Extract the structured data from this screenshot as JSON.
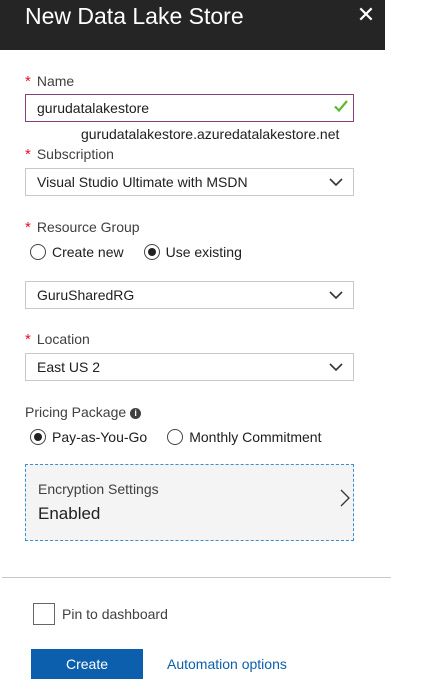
{
  "header": {
    "title": "New Data Lake Store",
    "close_glyph": "✕"
  },
  "required_marker": "*",
  "name_field": {
    "label": "Name",
    "value": "gurudatalakestore",
    "hint": "gurudatalakestore.azuredatalakestore.net",
    "valid_icon": "check-icon"
  },
  "subscription": {
    "label": "Subscription",
    "selected": "Visual Studio Ultimate with MSDN"
  },
  "resource_group": {
    "label": "Resource Group",
    "options": [
      "Create new",
      "Use existing"
    ],
    "selected_option": "Use existing",
    "selected": "GuruSharedRG"
  },
  "location": {
    "label": "Location",
    "selected": "East US 2"
  },
  "pricing": {
    "label": "Pricing Package",
    "info_glyph": "i",
    "options": [
      "Pay-as-You-Go",
      "Monthly Commitment"
    ],
    "selected_option": "Pay-as-You-Go"
  },
  "encryption": {
    "title": "Encryption Settings",
    "value": "Enabled"
  },
  "footer": {
    "pin_label": "Pin to dashboard",
    "create_label": "Create",
    "automation_label": "Automation options"
  },
  "colors": {
    "header_bg": "#252526",
    "primary": "#0b5fad",
    "required": "#e81123",
    "valid": "#5cb82e"
  }
}
